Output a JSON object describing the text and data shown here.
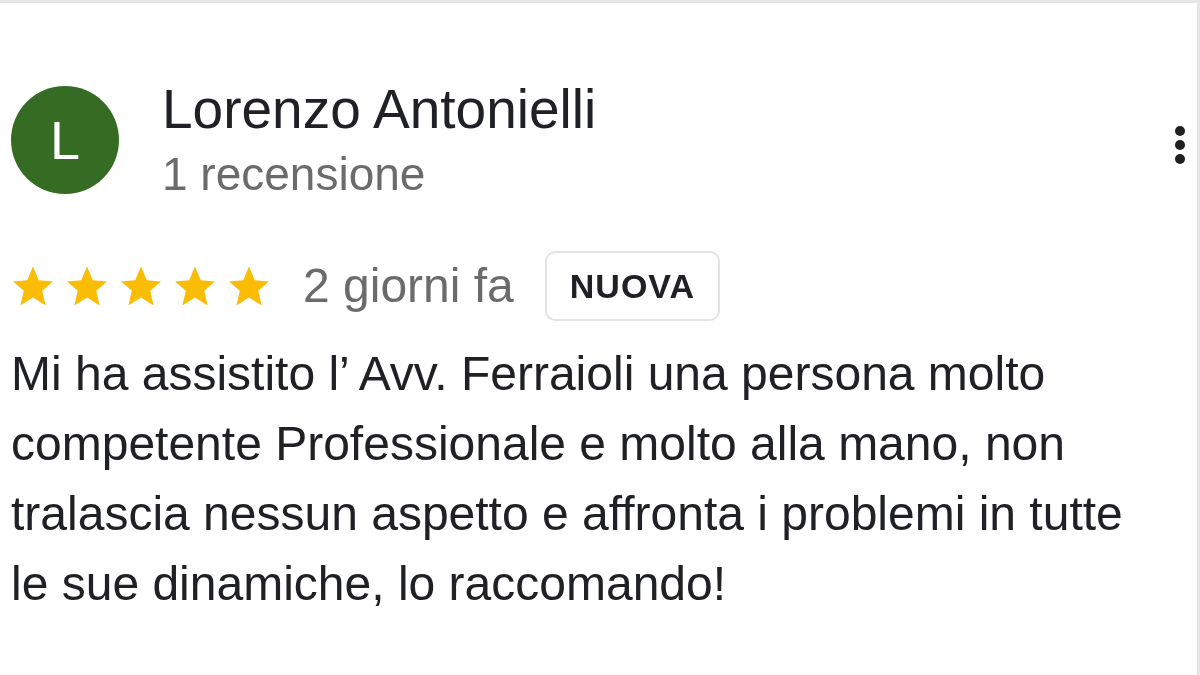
{
  "review": {
    "author": {
      "initial": "L",
      "name": "Lorenzo Antonielli",
      "review_count": "1 recensione"
    },
    "stars": 5,
    "time": "2 giorni fa",
    "badge": "NUOVA",
    "text": "Mi ha assistito l’ Avv. Ferraioli una persona molto competente Professionale e molto alla mano, non tralascia nessun aspetto e affronta i problemi in tutte le sue dinamiche, lo raccomando!"
  }
}
